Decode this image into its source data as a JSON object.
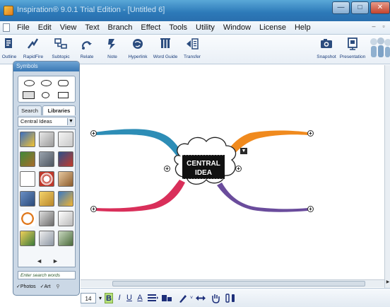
{
  "window": {
    "title": "Inspiration® 9.0.1 Trial Edition - [Untitled 6]",
    "buttons": [
      "—",
      "□",
      "✕"
    ]
  },
  "menu": [
    "File",
    "Edit",
    "View",
    "Text",
    "Branch",
    "Effect",
    "Tools",
    "Utility",
    "Window",
    "License",
    "Help"
  ],
  "mdi_controls": [
    "–",
    "▫"
  ],
  "toolbar": {
    "left": [
      {
        "label": "Outline",
        "icon": "outline-icon"
      },
      {
        "label": "RapidFire",
        "icon": "rapidfire-icon"
      },
      {
        "label": "Subtopic",
        "icon": "subtopic-icon"
      },
      {
        "label": "Relate",
        "icon": "relate-icon"
      },
      {
        "label": "Note",
        "icon": "note-icon"
      },
      {
        "label": "Hyperlink",
        "icon": "hyperlink-icon"
      },
      {
        "label": "Word Guide",
        "icon": "word-guide-icon"
      },
      {
        "label": "Transfer",
        "icon": "transfer-icon"
      }
    ],
    "right": [
      {
        "label": "Snapshot",
        "icon": "camera-icon"
      },
      {
        "label": "Presentation",
        "icon": "presentation-icon"
      }
    ]
  },
  "palette": {
    "title": "Symbols",
    "tabs": [
      "Search",
      "Libraries"
    ],
    "active_tab": "Libraries",
    "library_select": "Central Ideas",
    "search_placeholder": "Enter search words",
    "filters": {
      "photos": "Photos",
      "art": "Art"
    },
    "nav": [
      "◄",
      "►"
    ]
  },
  "central_idea": {
    "line1": "CENTRAL",
    "line2": "IDEA"
  },
  "formatbar": {
    "font_size": "14",
    "bold": "B",
    "italic": "I",
    "underline": "U",
    "color": "A"
  },
  "colors": {
    "branch_top_left": "#2d8db6",
    "branch_top_right": "#f08a1e",
    "branch_bottom_left": "#d92f5a",
    "branch_bottom_right": "#6a4c9c"
  }
}
